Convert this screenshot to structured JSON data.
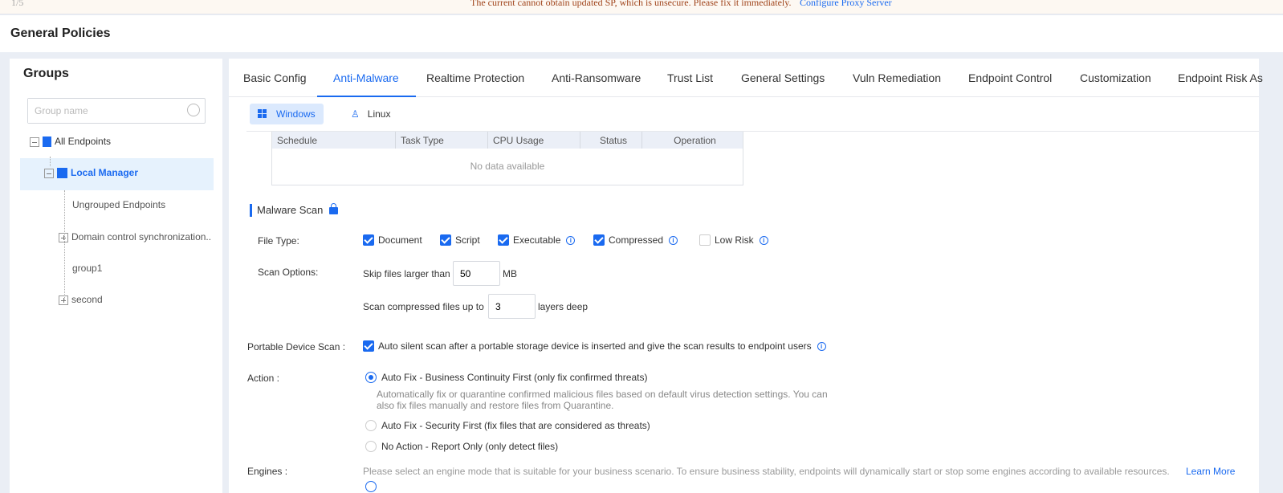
{
  "banner": {
    "pagination": "1/5",
    "message": "The current cannot obtain updated SP, which is unsecure. Please fix it immediately.",
    "link": "Configure Proxy Server"
  },
  "header": {
    "title": "General Policies"
  },
  "groups": {
    "title": "Groups",
    "search_placeholder": "Group name",
    "items": [
      "All Endpoints",
      "Local Manager",
      "Ungrouped Endpoints",
      "Domain control synchronization..",
      "group1",
      "second"
    ]
  },
  "tabs": [
    "Basic Config",
    "Anti-Malware",
    "Realtime Protection",
    "Anti-Ransomware",
    "Trust List",
    "General Settings",
    "Vuln Remediation",
    "Endpoint Control",
    "Customization",
    "Endpoint Risk As"
  ],
  "os_tabs": [
    "Windows",
    "Linux"
  ],
  "table": {
    "columns": [
      "Schedule",
      "Task Type",
      "CPU Usage",
      "Status",
      "Operation"
    ],
    "empty": "No data available"
  },
  "malware_scan": {
    "title": "Malware Scan",
    "file_type_label": "File Type:",
    "file_types": [
      {
        "label": "Document",
        "checked": true
      },
      {
        "label": "Script",
        "checked": true
      },
      {
        "label": "Executable",
        "checked": true
      },
      {
        "label": "Compressed",
        "checked": true
      },
      {
        "label": "Low Risk",
        "checked": false
      }
    ],
    "scan_options_label": "Scan Options:",
    "skip_prefix": "Skip files larger than",
    "skip_value": "50",
    "skip_unit": "MB",
    "compressed_prefix": "Scan compressed files up to",
    "compressed_value": "3",
    "compressed_suffix": "layers deep",
    "portable_label": "Portable Device Scan :",
    "portable_text": "Auto silent scan after a portable storage device is inserted and give the scan results to endpoint users",
    "action_label": "Action :",
    "actions": [
      "Auto Fix - Business Continuity First (only fix confirmed threats)",
      "Auto Fix - Security First (fix files that are considered as threats)",
      "No Action - Report Only (only detect files)"
    ],
    "action_desc": "Automatically fix or quarantine confirmed malicious files based on default virus detection settings. You can also fix files manually and restore files from Quarantine.",
    "engines_label": "Engines :",
    "engines_text": "Please select an engine mode that is suitable for your business scenario. To ensure business stability, endpoints will dynamically start or stop some engines according to available resources.",
    "learn_more": "Learn More"
  },
  "colors": {
    "accent": "#1a6af0"
  }
}
